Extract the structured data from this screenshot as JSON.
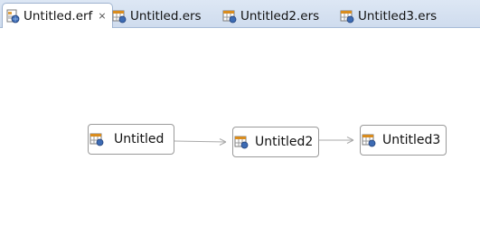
{
  "tabs": [
    {
      "label": "Untitled.erf",
      "icon": "erf-diagram-icon",
      "active": true,
      "close_glyph": "⨯"
    },
    {
      "label": "Untitled.ers",
      "icon": "ers-schema-icon",
      "active": false
    },
    {
      "label": "Untitled2.ers",
      "icon": "ers-schema-icon",
      "active": false
    },
    {
      "label": "Untitled3.ers",
      "icon": "ers-schema-icon",
      "active": false
    }
  ],
  "diagram": {
    "nodes": [
      {
        "label": "Untitled",
        "icon": "schema-node-icon"
      },
      {
        "label": "Untitled2",
        "icon": "schema-node-icon"
      },
      {
        "label": "Untitled3",
        "icon": "schema-node-icon"
      }
    ],
    "connections": [
      {
        "from": "Untitled",
        "to": "Untitled2"
      },
      {
        "from": "Untitled2",
        "to": "Untitled3"
      }
    ]
  },
  "colors": {
    "tab_bar": "#d5e1f0",
    "node_border": "#9a9a9a",
    "connector": "#a9a9a9",
    "icon_grid_header": "#d98c1e",
    "icon_globe": "#3d6bb3"
  }
}
